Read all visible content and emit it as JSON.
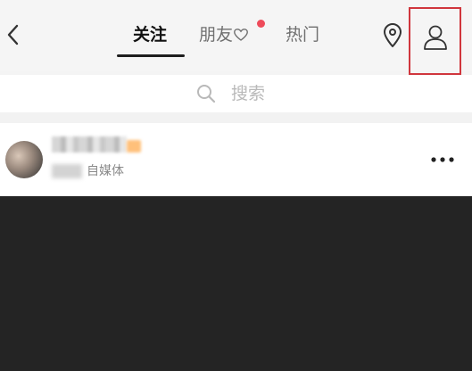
{
  "header": {
    "tabs": [
      {
        "label": "关注",
        "active": true
      },
      {
        "label": "朋友",
        "active": false,
        "has_heart": true,
        "has_notification_dot": true
      },
      {
        "label": "热门",
        "active": false
      }
    ],
    "icons": [
      "back-icon",
      "location-pin-icon",
      "person-icon"
    ]
  },
  "search": {
    "placeholder": "搜索"
  },
  "feed": {
    "post": {
      "username": "",
      "subtitle": "自媒体"
    }
  },
  "colors": {
    "accent_underline": "#1e1e1e",
    "notification_dot": "#ee4b5a",
    "highlight_box": "#d0363d",
    "video_background": "#242424"
  }
}
